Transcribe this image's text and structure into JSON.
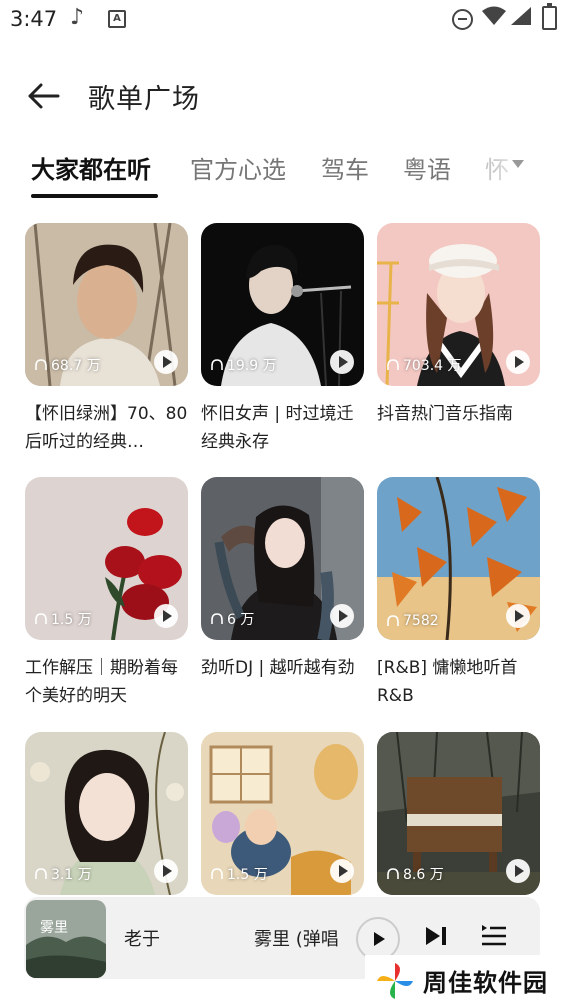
{
  "status_bar": {
    "time": "3:47",
    "app_icon_letter": "A"
  },
  "header": {
    "title": "歌单广场",
    "back_icon": "arrow-left-icon"
  },
  "tabs": [
    {
      "label": "大家都在听",
      "active": true
    },
    {
      "label": "官方心选",
      "active": false
    },
    {
      "label": "驾车",
      "active": false
    },
    {
      "label": "粤语",
      "active": false
    },
    {
      "label": "怀",
      "active": false
    }
  ],
  "playlists": [
    {
      "title": "【怀旧绿洲】70、80后听过的经典…",
      "plays": "68.7 万"
    },
    {
      "title": "怀旧女声 | 时过境迁 经典永存",
      "plays": "19.9 万"
    },
    {
      "title": "抖音热门音乐指南",
      "plays": "703.4 万"
    },
    {
      "title": "工作解压｜期盼着每个美好的明天",
      "plays": "1.5 万"
    },
    {
      "title": "劲听DJ | 越听越有劲",
      "plays": "6 万"
    },
    {
      "title": "[R&B] 慵懒地听首R&B",
      "plays": "7582"
    },
    {
      "title": "",
      "plays": "3.1 万"
    },
    {
      "title": "",
      "plays": "1.5 万"
    },
    {
      "title": "",
      "plays": "8.6 万"
    }
  ],
  "player": {
    "artist": "老于",
    "song": "雾里 (弹唱",
    "thumb_text": "雾里"
  },
  "watermark": {
    "text": "周佳软件园"
  }
}
